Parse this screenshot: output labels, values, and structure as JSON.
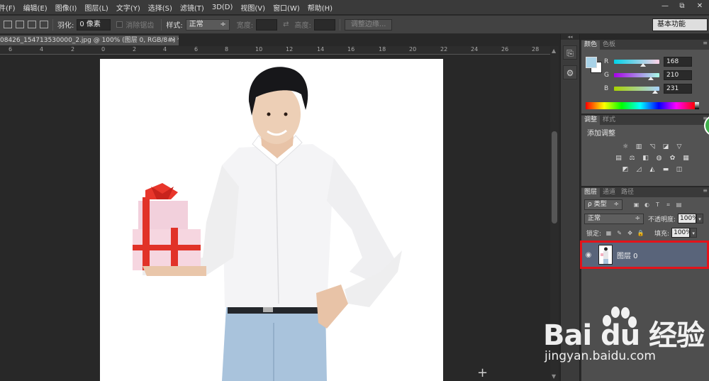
{
  "menu": [
    "件(F)",
    "编辑(E)",
    "图像(I)",
    "图层(L)",
    "文字(Y)",
    "选择(S)",
    "滤镜(T)",
    "3D(D)",
    "视图(V)",
    "窗口(W)",
    "帮助(H)"
  ],
  "window_buttons": [
    "—",
    "⧉",
    "✕"
  ],
  "options": {
    "feather_label": "羽化:",
    "feather_value": "0 像素",
    "antialias_label": "消除锯齿",
    "style_label": "样式:",
    "style_value": "正常",
    "width_label": "宽度:",
    "height_label": "高度:",
    "refine_button": "调整边缘...",
    "workspace": "基本功能"
  },
  "document_tab": {
    "title": "08426_154713530000_2.jpg @ 100% (图层 0, RGB/8#) *",
    "close": "×"
  },
  "ruler_labels": [
    "6",
    "4",
    "2",
    "0",
    "2",
    "4",
    "6",
    "8",
    "10",
    "12",
    "14",
    "16",
    "18",
    "20",
    "22",
    "24",
    "26",
    "28"
  ],
  "panels": {
    "color_tabs": [
      "颜色",
      "色板"
    ],
    "color": {
      "r_label": "R",
      "g_label": "G",
      "b_label": "B",
      "r": "168",
      "g": "210",
      "b": "231",
      "foreground_hex": "#a8d2e7"
    },
    "adjust_tabs": [
      "调整",
      "样式"
    ],
    "adjust_title": "添加调整",
    "layers_tabs": [
      "图层",
      "通道",
      "路径"
    ],
    "layers": {
      "filter_type": "ρ 类型",
      "blend_mode": "正常",
      "opacity_label": "不透明度:",
      "opacity": "100%",
      "lock_label": "锁定:",
      "fill_label": "填充:",
      "fill": "100%",
      "layer_name": "图层 0"
    }
  },
  "watermark": {
    "brand": "Bai du 经验",
    "url": "jingyan.baidu.com"
  },
  "icons": {
    "eye": "👁",
    "crosshair": "+"
  }
}
